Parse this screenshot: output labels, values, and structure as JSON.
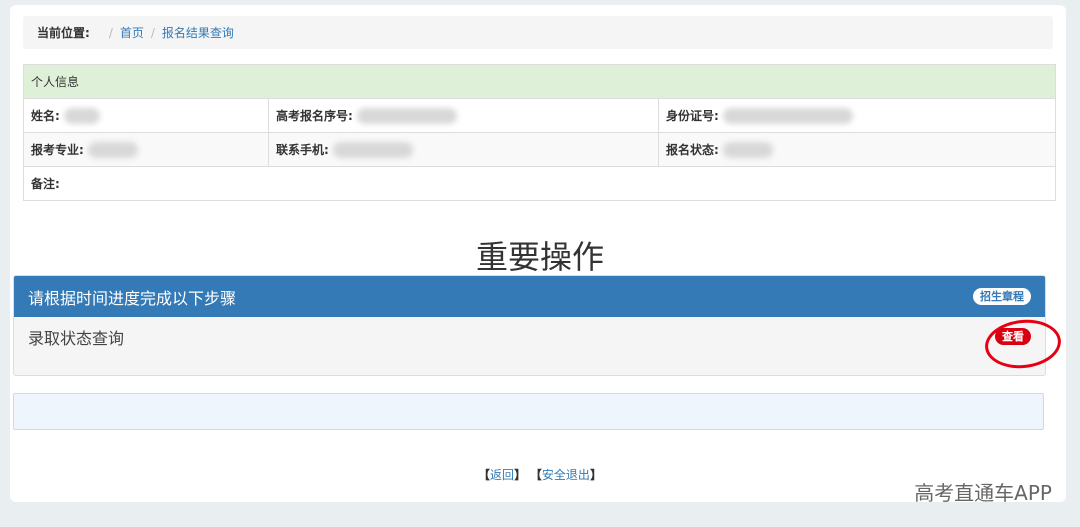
{
  "breadcrumb": {
    "label": "当前位置:",
    "separator": "/",
    "home": "首页",
    "current": "报名结果查询"
  },
  "personal_info": {
    "header": "个人信息",
    "name_label": "姓名:",
    "reg_no_label": "高考报名序号:",
    "id_label": "身份证号:",
    "major_label": "报考专业:",
    "phone_label": "联系手机:",
    "status_label": "报名状态:",
    "remark_label": "备注:"
  },
  "section_title": "重要操作",
  "steps_panel": {
    "title": "请根据时间进度完成以下步骤",
    "badge": "招生章程",
    "item_label": "录取状态查询",
    "item_button": "查看"
  },
  "footer": {
    "back_open": "【",
    "back": "返回",
    "back_close": "】",
    "logout_open": "【",
    "logout": "安全退出",
    "logout_close": "】"
  },
  "watermark": "高考直通车APP",
  "colors": {
    "primary": "#337ab7",
    "success_bg": "#dff0d8",
    "highlight_red": "#e60012"
  }
}
